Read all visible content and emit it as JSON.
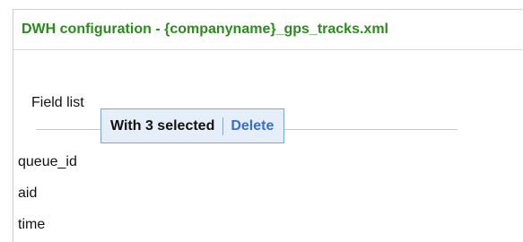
{
  "panel": {
    "title": "DWH configuration - {companyname}_gps_tracks.xml"
  },
  "field_list": {
    "label": "Field list",
    "items": [
      "queue_id",
      "aid",
      "time"
    ]
  },
  "selection_popup": {
    "count_text": "With 3 selected",
    "delete_label": "Delete"
  },
  "colors": {
    "title": "#2c8a1e",
    "popup_background": "#e6eef9",
    "popup_border": "#7ea3d6",
    "link": "#3a6fc2"
  }
}
